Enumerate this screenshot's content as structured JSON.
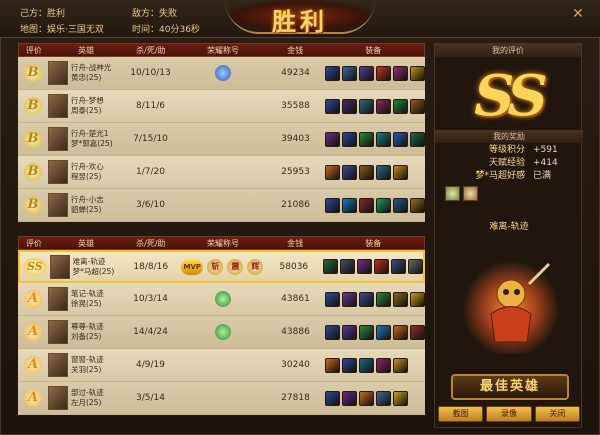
{
  "header": {
    "our_side_label": "己方：",
    "our_side_result": "胜利",
    "enemy_side_label": "敌方：",
    "enemy_side_result": "失败",
    "map_label": "地图：",
    "map_name": "娱乐·三国无双",
    "time_label": "时间：",
    "time_value": "40分36秒",
    "title": "胜利"
  },
  "columns": {
    "rating": "评价",
    "hero": "英雄",
    "kda": "杀/死/助",
    "honor": "荣耀称号",
    "gold": "金钱",
    "equipment": "装备"
  },
  "team_a": [
    {
      "grade": "B",
      "hero_line1": "行舟-战神光",
      "hero_line2": "黄忠(25)",
      "kda": "10/10/13",
      "honors": [
        "blue-badge"
      ],
      "gold": "49234",
      "equip_colors": [
        "#2a4aa0",
        "#3a6a9a",
        "#5a3a9a",
        "#c83a1a",
        "#9a2a7a",
        "#c8901a"
      ]
    },
    {
      "grade": "B",
      "hero_line1": "行舟-梦想",
      "hero_line2": "周泰(25)",
      "kda": "8/11/6",
      "honors": [],
      "gold": "35588",
      "equip_colors": [
        "#2a4aa0",
        "#4a2a6a",
        "#2a6a8a",
        "#8a2a5a",
        "#1a8a3a",
        "#9a5a1a"
      ]
    },
    {
      "grade": "B",
      "hero_line1": "行舟-楚光1",
      "hero_line2": "梦*郭嘉(25)",
      "kda": "7/15/10",
      "honors": [],
      "gold": "39403",
      "equip_colors": [
        "#6a2a8a",
        "#2a4aa0",
        "#2a8a3a",
        "#1a7a8a",
        "#2a5ac0",
        "#1a6a4a"
      ]
    },
    {
      "grade": "B",
      "hero_line1": "行舟-欢心",
      "hero_line2": "程昱(25)",
      "kda": "1/7/20",
      "honors": [],
      "gold": "25953",
      "equip_colors": [
        "#c86a1a",
        "#3a4a9a",
        "#8a5a1a",
        "#2a6a8a",
        "#c88a1a"
      ]
    },
    {
      "grade": "B",
      "hero_line1": "行舟-小志",
      "hero_line2": "貂蝉(25)",
      "kda": "3/6/10",
      "honors": [],
      "gold": "21086",
      "equip_colors": [
        "#2a4aa0",
        "#1a7ac0",
        "#8a2a2a",
        "#1a9a6a",
        "#2a5a8a",
        "#9a6a1a"
      ]
    }
  ],
  "team_b": [
    {
      "grade": "SS",
      "hero_line1": "难离-轨迹",
      "hero_line2": "梦*马超(25)",
      "kda": "18/8/16",
      "honors": [
        "MVP",
        "斩",
        "震",
        "辉"
      ],
      "gold": "58036",
      "equip_colors": [
        "#2a6a3a",
        "#4a4a6a",
        "#7a2a8a",
        "#c82a2a",
        "#3a4a8a",
        "#6a6a6a"
      ],
      "highlight": true
    },
    {
      "grade": "A",
      "hero_line1": "笔记-轨迹",
      "hero_line2": "徐晃(25)",
      "kda": "10/3/14",
      "honors": [
        "green-badge"
      ],
      "gold": "43861",
      "equip_colors": [
        "#2a4aa0",
        "#6a3a9a",
        "#3a4a9a",
        "#2a8a3a",
        "#8a6a1a",
        "#c8a01a"
      ]
    },
    {
      "grade": "A",
      "hero_line1": "尊尊-轨迹",
      "hero_line2": "刘备(25)",
      "kda": "14/4/24",
      "honors": [
        "green-badge"
      ],
      "gold": "43886",
      "equip_colors": [
        "#2a4aa0",
        "#5a3a9a",
        "#2a8a3a",
        "#1a7ac0",
        "#c86a1a",
        "#9a2a2a"
      ]
    },
    {
      "grade": "A",
      "hero_line1": "窗窗-轨迹",
      "hero_line2": "关羽(25)",
      "kda": "4/9/19",
      "honors": [],
      "gold": "30240",
      "equip_colors": [
        "#c86a1a",
        "#2a4aa0",
        "#1a6a8a",
        "#8a2a6a",
        "#c8901a"
      ]
    },
    {
      "grade": "A",
      "hero_line1": "部过-轨迹",
      "hero_line2": "左月(25)",
      "kda": "3/5/14",
      "honors": [],
      "gold": "27818",
      "equip_colors": [
        "#2a4aa0",
        "#6a2a8a",
        "#c86a1a",
        "#3a6a9a",
        "#c8a01a"
      ]
    }
  ],
  "right_panel": {
    "my_rating_tab": "我的评价",
    "my_grade": "SS",
    "my_reward_tab": "我的奖励",
    "rewards": [
      {
        "label": "等级积分",
        "value": "+591"
      },
      {
        "label": "天赋经验",
        "value": "+414"
      },
      {
        "label": "梦*马超好感",
        "value": "已满"
      }
    ],
    "reward_item_colors": [
      "#6a8a3a",
      "#9a6a2a"
    ],
    "best_player_name": "难离-轨迹",
    "best_hero_badge": "最佳英雄",
    "buttons": {
      "share": "截图",
      "replay": "录像",
      "close": "关闭"
    }
  },
  "icons": {
    "close": "close-icon"
  }
}
